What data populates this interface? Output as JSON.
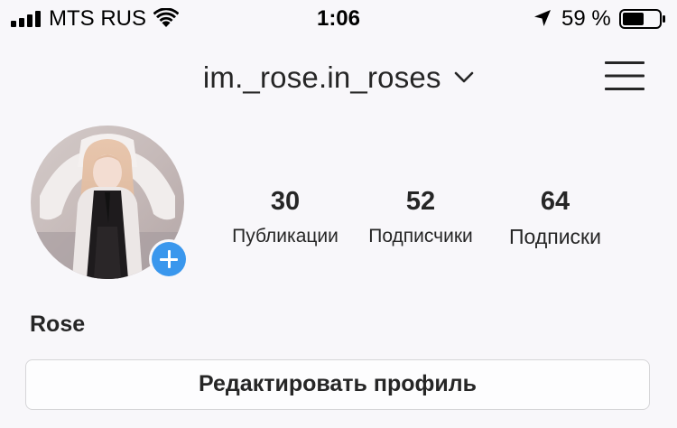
{
  "status_bar": {
    "carrier": "MTS RUS",
    "time": "1:06",
    "battery_percent": "59 %",
    "battery_level": 0.59,
    "signal_bars": 4,
    "icons": [
      "signal-icon",
      "wifi-icon",
      "location-arrow-icon",
      "battery-icon"
    ]
  },
  "header": {
    "username": "im._rose.in_roses",
    "icons": [
      "chevron-down-icon",
      "hamburger-menu-icon"
    ]
  },
  "profile": {
    "display_name": "Rose",
    "avatar_icon": "avatar-photo",
    "add_story_icon": "plus-icon",
    "add_story_color": "#3a97ed",
    "stats": {
      "posts": {
        "value": "30",
        "label": "Публикации"
      },
      "followers": {
        "value": "52",
        "label": "Подписчики"
      },
      "following": {
        "value": "64",
        "label": "Подписки"
      }
    },
    "edit_button_label": "Редактировать профиль"
  }
}
